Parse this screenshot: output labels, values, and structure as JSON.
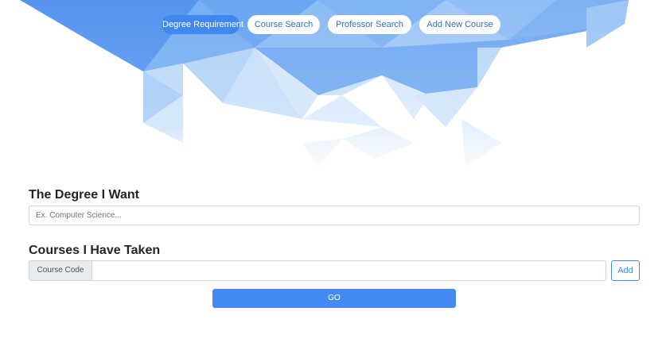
{
  "nav": {
    "items": [
      {
        "label": "Degree Requirement",
        "active": true
      },
      {
        "label": "Course Search",
        "active": false
      },
      {
        "label": "Professor Search",
        "active": false
      },
      {
        "label": "Add New Course",
        "active": false
      }
    ]
  },
  "degree": {
    "title": "The Degree I Want",
    "placeholder": "Ex. Computer Science...",
    "value": ""
  },
  "courses": {
    "title": "Courses I Have Taken",
    "prefix_label": "Course Code",
    "value": "",
    "add_label": "Add"
  },
  "go_label": "GO",
  "colors": {
    "accent": "#3f88ee",
    "hero_blue": "#4a8fee",
    "pill_text": "#3a6fb8"
  }
}
